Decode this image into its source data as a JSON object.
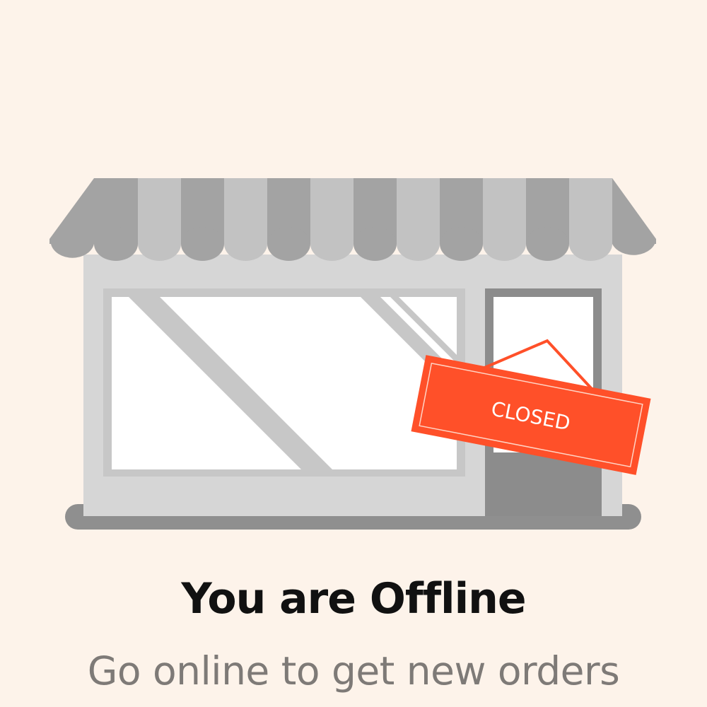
{
  "status": {
    "title": "You are Offline",
    "message": "Go online to get new orders"
  },
  "sign": {
    "label": "CLOSED"
  },
  "icons": {
    "illustration": "closed-storefront-icon"
  },
  "colors": {
    "background": "#FDF3EA",
    "sign": "#FF5029",
    "building": "#D6D6D6",
    "awning_dark": "#A3A3A3",
    "awning_light": "#C2C2C2",
    "door": "#8C8C8C",
    "title_text": "#111111",
    "message_text": "#7E7A77"
  }
}
